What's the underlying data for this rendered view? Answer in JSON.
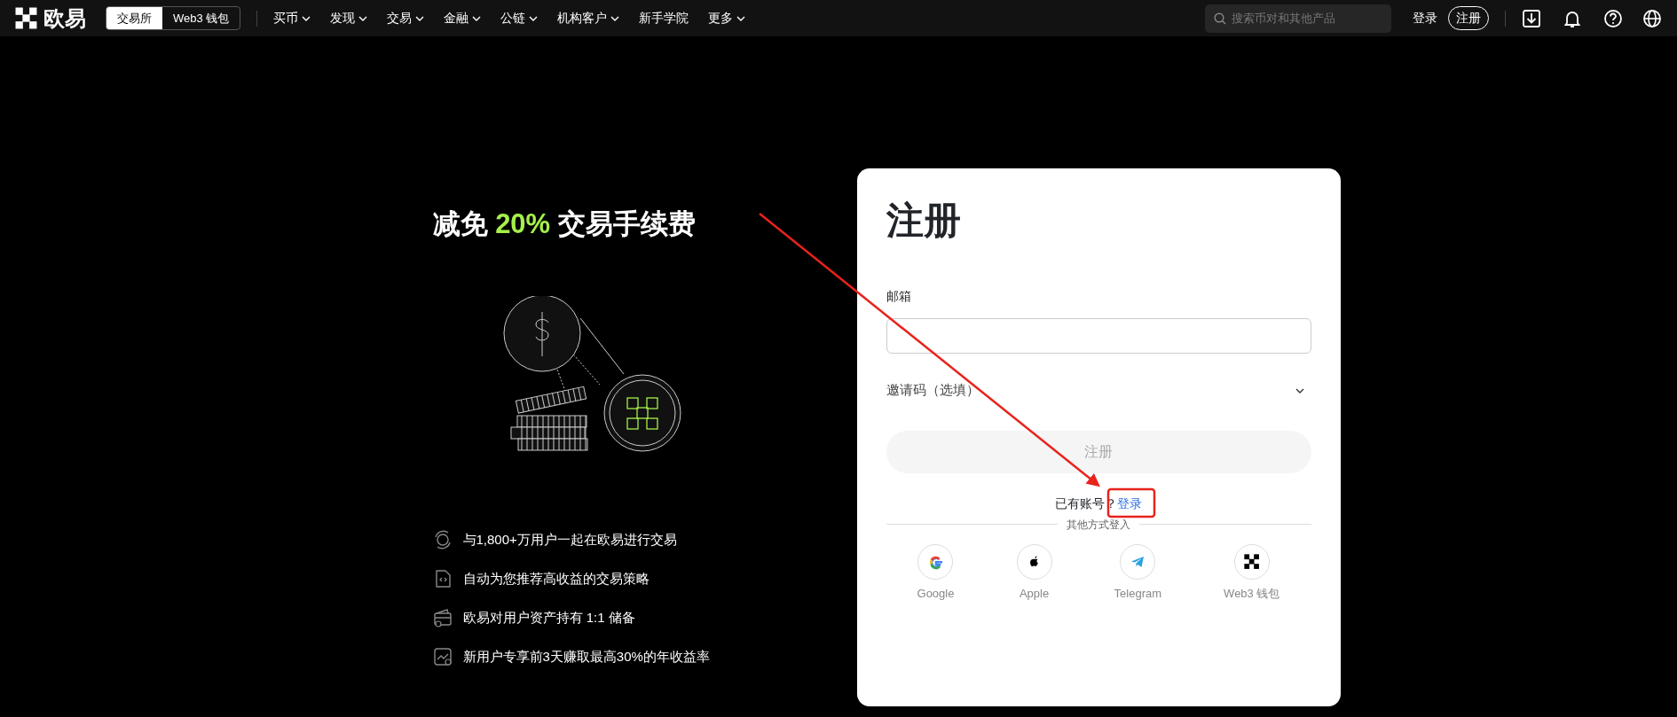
{
  "nav": {
    "logo_text": "欧易",
    "mode_tabs": [
      {
        "label": "交易所",
        "selected": true
      },
      {
        "label": "Web3 钱包",
        "selected": false
      }
    ],
    "menu": [
      {
        "label": "买币",
        "dropdown": true
      },
      {
        "label": "发现",
        "dropdown": true
      },
      {
        "label": "交易",
        "dropdown": true
      },
      {
        "label": "金融",
        "dropdown": true
      },
      {
        "label": "公链",
        "dropdown": true
      },
      {
        "label": "机构客户",
        "dropdown": true
      },
      {
        "label": "新手学院",
        "dropdown": false
      },
      {
        "label": "更多",
        "dropdown": true
      }
    ],
    "search": {
      "placeholder": "搜索币对和其他产品"
    },
    "login": "登录",
    "register": "注册"
  },
  "promo": {
    "headline": {
      "before": "减免 ",
      "highlight": "20%",
      "after": " 交易手续费"
    },
    "features": [
      {
        "kind": "users",
        "text": "与1,800+万用户一起在欧易进行交易"
      },
      {
        "kind": "code",
        "text": "自动为您推荐高收益的交易策略"
      },
      {
        "kind": "wallet",
        "text": "欧易对用户资产持有 1:1 储备"
      },
      {
        "kind": "chart",
        "text": "新用户专享前3天赚取最高30%的年收益率"
      }
    ]
  },
  "form": {
    "title": "注册",
    "email_label": "邮箱",
    "invite_label": "邀请码（选填）",
    "invite_expanded": false,
    "submit": {
      "label": "注册",
      "disabled": true
    },
    "have_account": "已有账号？",
    "login_link": "登录",
    "other_methods": "其他方式登入",
    "social": [
      {
        "kind": "google",
        "label": "Google"
      },
      {
        "kind": "apple",
        "label": "Apple"
      },
      {
        "kind": "telegram",
        "label": "Telegram"
      },
      {
        "kind": "wallet",
        "label": "Web3 钱包"
      }
    ]
  },
  "annotation": {
    "kind": "arrow-to-box"
  }
}
